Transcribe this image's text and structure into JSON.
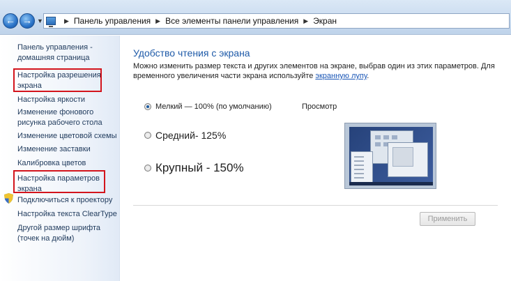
{
  "breadcrumb": {
    "items": [
      "Панель управления",
      "Все элементы панели управления",
      "Экран"
    ]
  },
  "sidebar": {
    "home": "Панель управления - домашняя страница",
    "items": [
      "Настройка разрешения экрана",
      "Настройка яркости",
      "Изменение фонового рисунка рабочего стола",
      "Изменение цветовой схемы",
      "Изменение заставки",
      "Калибровка цветов",
      "Настройка параметров экрана",
      "Подключиться к проектору",
      "Настройка текста ClearType",
      "Другой размер шрифта (точек на дюйм)"
    ]
  },
  "main": {
    "title": "Удобство чтения с экрана",
    "description": "Можно изменить размер текста и других элементов на экране, выбрав один из этих параметров. Для временного увеличения части экрана используйте",
    "link": "экранную лупу",
    "link_suffix": ".",
    "options": [
      {
        "label": "Мелкий — 100% (по умолчанию)",
        "checked": true
      },
      {
        "label": "Средний- 125%",
        "checked": false
      },
      {
        "label": "Крупный - 150%",
        "checked": false
      }
    ],
    "preview_label": "Просмотр",
    "apply_label": "Применить"
  },
  "colors": {
    "accent": "#1e5aa8",
    "highlight_box": "#d3141c"
  }
}
